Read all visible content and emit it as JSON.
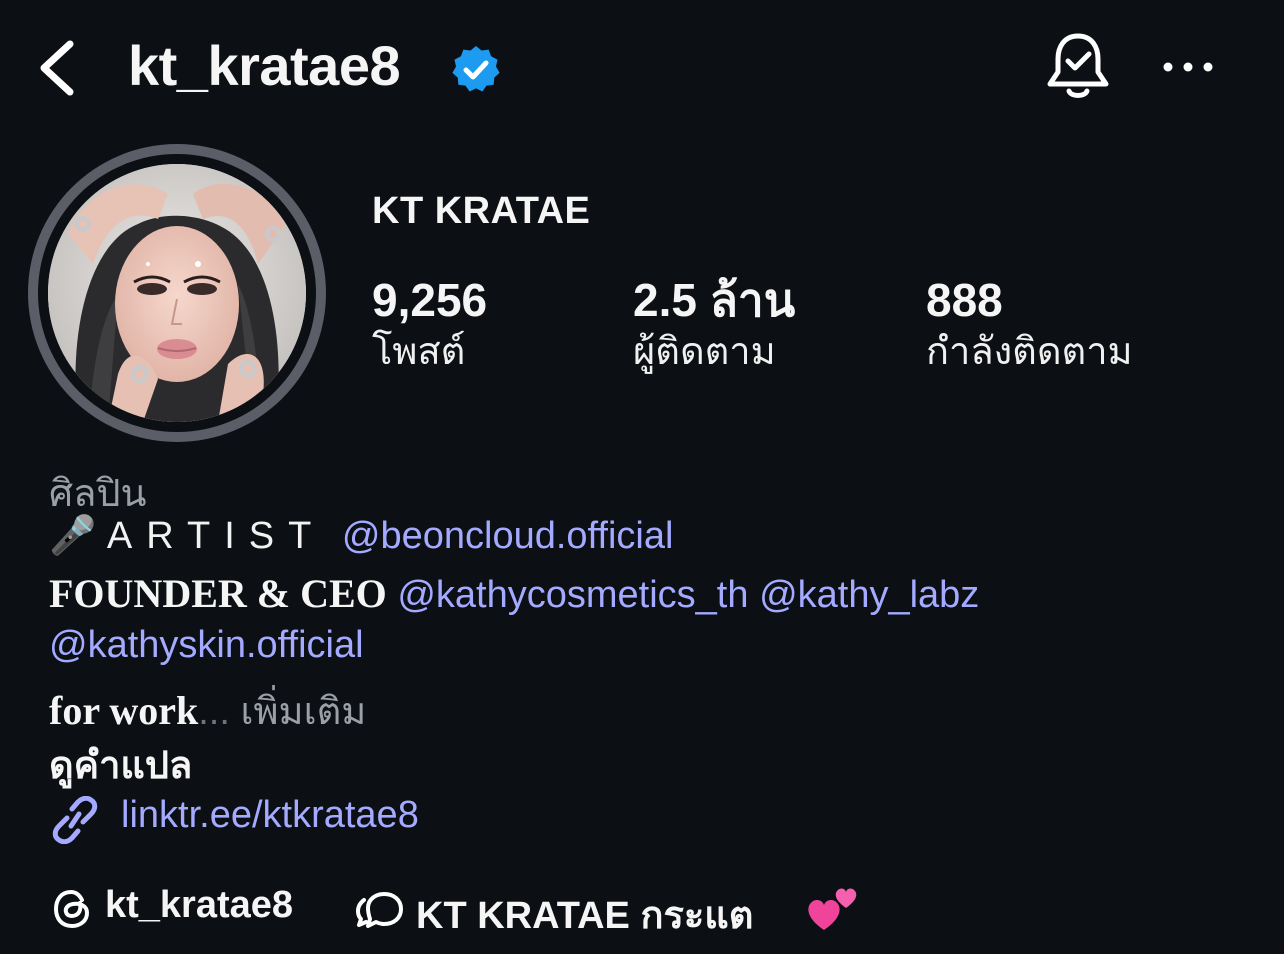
{
  "header": {
    "username": "kt_kratae8",
    "verified": true,
    "icons": [
      "chevron-left-icon",
      "verified-badge-icon",
      "notification-bell-check-icon",
      "more-options-icon"
    ]
  },
  "profile": {
    "display_name": "KT KRATAE",
    "stats": [
      {
        "value": "9,256",
        "label": "โพสต์"
      },
      {
        "value": "2.5 ล้าน",
        "label": "ผู้ติดตาม"
      },
      {
        "value": "888",
        "label": "กำลังติดตาม"
      }
    ]
  },
  "bio": {
    "category": "ศิลปิน",
    "artist_emoji": "🎤",
    "artist_word": "ARTIST",
    "artist_mention": "@beoncloud.official",
    "founder_text": "FOUNDER & CEO",
    "founder_mentions": [
      "@kathycosmetics_th",
      "@kathy_labz"
    ],
    "skin_mention": "@kathyskin.official",
    "work_text": "for work",
    "ellipsis": "...",
    "more_label": "เพิ่มเติม",
    "translate_label": "ดูคำแปล",
    "link_text": "linktr.ee/ktkratae8"
  },
  "footer": {
    "threads_handle": "kt_kratae8",
    "channel_name": "KT KRATAE  กระแต",
    "hearts_emoji": "💕"
  },
  "colors": {
    "background": "#0c0f14",
    "text": "#f5f5f5",
    "muted": "#9aa0a6",
    "link": "#a3aaff",
    "verified_blue": "#1d9bf0",
    "avatar_ring": "#5b5e66"
  }
}
